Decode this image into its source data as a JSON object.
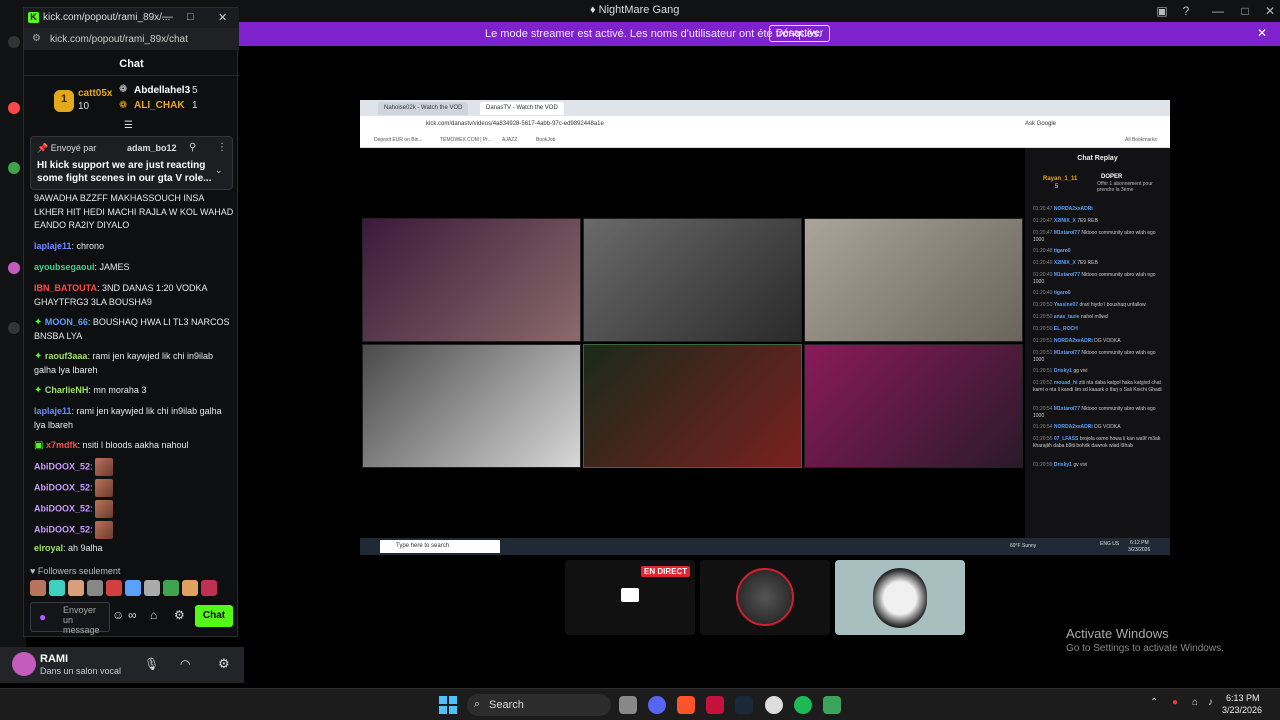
{
  "discord": {
    "title": "NightMare Gang",
    "notice_text": "Le mode streamer est activé. Les noms d'utilisateur ont été tronqués.",
    "notice_button": "Désactiver",
    "user_name": "RAMI",
    "user_status": "Dans un salon vocal"
  },
  "kick": {
    "window_title": "kick.com/popout/rami_89x/...",
    "url": "kick.com/popout/rami_89x/chat",
    "chat_title": "Chat",
    "gifters": [
      {
        "rank": "1",
        "name": "catt05x",
        "count": "10"
      },
      {
        "name": "Abdellahel3",
        "count": "5"
      },
      {
        "name": "ALI_CHAK",
        "count": "1"
      }
    ],
    "pinned": {
      "by_label": "Envoyé par",
      "user": "adam_bo12",
      "text": "HI kick support we are just reacting some fight scenes in our gta V role..."
    },
    "messages": [
      {
        "user": "",
        "text": "9AWADHA BZZFF MAKHASSOUCH INSA LKHER HIT HEDI MACHI RAJLA W KOL WAHAD EANDO RA2IY DIYALO",
        "color": "#e8e8e8"
      },
      {
        "user": "laplaje11",
        "text": ": chrono",
        "color": "#6b8bff"
      },
      {
        "user": "ayoubsegaoui",
        "text": ": JAMES",
        "color": "#3fd08c"
      },
      {
        "user": "IBN_BATOUTA",
        "text": ": 3ND DANAS 1:20 VODKA GHAYTFRG3 3LA BOUSHA9",
        "color": "#ff4848"
      },
      {
        "user": "MOON_66",
        "text": ": BOUSHAQ HWA LI TL3 NARCOS BNSBA LYA",
        "color": "#5aa0ff"
      },
      {
        "user": "raouf3aaa",
        "text": ": rami jen kaywjed lik chi in9ilab galha lya lbareh",
        "color": "#9be36a"
      },
      {
        "user": "CharlieNH",
        "text": ": mn moraha 3",
        "color": "#9be36a"
      },
      {
        "user": "laplaje11",
        "text": ": rami jen kaywjed lik chi in9ilab galha lya lbareh",
        "color": "#6b8bff"
      },
      {
        "user": "x7mdfk",
        "text": ": nsiti l bloods aakha nahoul",
        "color": "#ff4848"
      },
      {
        "user": "AbiDOOX_52",
        "text": ":",
        "color": "#c99cff"
      },
      {
        "user": "AbiDOOX_52",
        "text": ":",
        "color": "#c99cff"
      },
      {
        "user": "AbiDOOX_52",
        "text": ":",
        "color": "#c99cff"
      },
      {
        "user": "AbiDOOX_52",
        "text": ":",
        "color": "#c99cff"
      },
      {
        "user": "elroyal",
        "text": ": ah 9alha",
        "color": "#9be36a"
      }
    ],
    "followers_label": "Followers seulement",
    "input_placeholder": "Envoyer un message",
    "send_label": "Chat"
  },
  "stream": {
    "tabs": [
      "Nahoise02k - Watch the VOD",
      "DanasTV - Watch the VOD"
    ],
    "url": "kick.com/danastv/videos/4a834928-5617-4abb-97c-ed9892448a1e",
    "bookmarks": [
      "Deposit EUR on Bin...",
      "TEMOWEX.COM | Pr...",
      "AJAZZ",
      "BookJob"
    ],
    "ask_google": "Ask Google",
    "all_bookmarks": "All Bookmarks",
    "replay_title": "Chat Replay",
    "replay_top": {
      "user": "Rayan_1_11",
      "count": "5",
      "badge": "DOPER",
      "sub": "Offrir 1 abonnement pour prendre la 3ème"
    },
    "replay_lines": [
      {
        "t": "01:20:47",
        "n": "NORDA2xxADRi",
        "m": ""
      },
      {
        "t": "01:20:47",
        "n": "X2INIX_X",
        "m": "7E9 REB"
      },
      {
        "t": "01:20:47",
        "n": "M1starol77",
        "m": "Nktooo community abro wlah ego 1000"
      },
      {
        "t": "01:20:48",
        "n": "tigaro0",
        "m": ""
      },
      {
        "t": "01:20:49",
        "n": "X2INIX_X",
        "m": "7E9 REB"
      },
      {
        "t": "01:20:49",
        "n": "M1starol77",
        "m": "Nktooo community abro wlah ego 1000"
      },
      {
        "t": "01:20:49",
        "n": "tigaro0",
        "m": ""
      },
      {
        "t": "01:20:50",
        "n": "Yassine07",
        "m": "drari hiydo l boushaq unfallow"
      },
      {
        "t": "01:20:50",
        "n": "anas_taxie",
        "m": "nahol m9wd"
      },
      {
        "t": "01:20:50",
        "n": "EL_ROCH",
        "m": ""
      },
      {
        "t": "01:20:51",
        "n": "NORDA2xxADRi",
        "m": "DG VODKA"
      },
      {
        "t": "01:20:51",
        "n": "M1starol77",
        "m": "Nktooo community abro wlah ego 1000"
      },
      {
        "t": "01:20:51",
        "n": "Drisky1",
        "m": "gg vivi"
      },
      {
        "t": "01:20:52",
        "n": "mouad_hi",
        "m": "ztii nta daba katgol haka katgivd chat kamt o nta li kandi lim sd kaaark o tfarj o Sali Koichi Ghadi"
      },
      {
        "t": "01:20:54",
        "n": "M1starol77",
        "m": "Nktooo community abro wlah ego 1000"
      },
      {
        "t": "01:20:54",
        "n": "NORDA2xxADRi",
        "m": "DG VODKA"
      },
      {
        "t": "01:20:55",
        "n": "07_LFASS",
        "m": "brojola osmo howa li kan wa9f m3ak kharajtih daba b9iti bohdk dawrok wlad l9hab"
      },
      {
        "t": "01:20:59",
        "n": "Drisky1",
        "m": "gv vivi"
      }
    ],
    "inner_search": "Type here to search",
    "inner_weather": "60°F Sunny",
    "inner_time": "6:12 PM",
    "inner_date": "3/23/2026",
    "inner_lang": "ENG US"
  },
  "tiles": {
    "live_badge": "EN DIRECT"
  },
  "activate": {
    "line1": "Activate Windows",
    "line2": "Go to Settings to activate Windows."
  },
  "taskbar": {
    "search": "Search",
    "time": "6:13 PM",
    "date": "3/23/2026"
  },
  "colors": {
    "kick_green": "#53fc18",
    "notice_purple": "#7e22ce",
    "live_red": "#e0262f"
  }
}
